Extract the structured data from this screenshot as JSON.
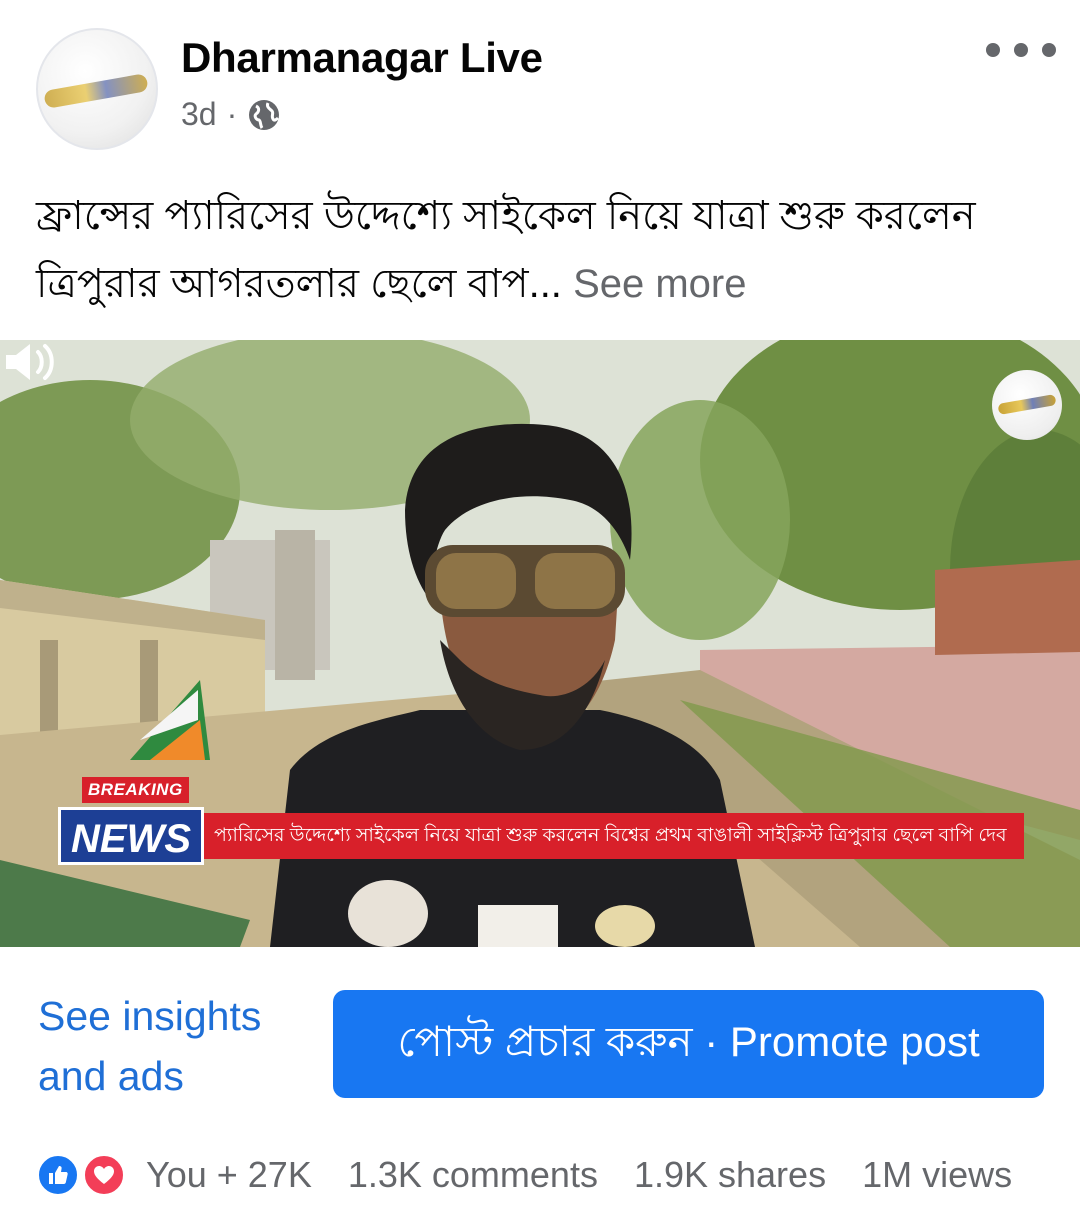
{
  "post": {
    "page_name": "Dharmanagar Live",
    "time": "3d",
    "separator": "·",
    "privacy_icon": "globe-icon",
    "more_icon": "more-options-icon",
    "caption": "ফ্রান্সের প্যারিসের উদ্দেশ্যে সাইকেল নিয়ে যাত্রা শুরু করলেন ত্রিপুরার আগরতলার ছেলে বাপ...",
    "see_more": "See more"
  },
  "video": {
    "breaking_label": "BREAKING",
    "news_label": "NEWS",
    "ticker_text": "প্যারিসের উদ্দেশ্যে সাইকেল নিয়ে যাত্রা  শুরু করলেন বিশ্বের প্রথম বাঙালী  সাইক্লিস্ট ত্রিপুরার ছেলে  বাপি দেব ",
    "mute_icon": "speaker-icon"
  },
  "actions": {
    "insights_label": "See insights and ads",
    "promote_label": "পোস্ট প্রচার করুন · Promote post"
  },
  "engagement": {
    "reactions": [
      "like-icon",
      "love-icon"
    ],
    "reaction_summary": "You + 27K",
    "comments": "1.3K comments",
    "shares": "1.9K shares",
    "views": "1M views"
  },
  "colors": {
    "accent": "#1877f2",
    "link": "#1f6fd6",
    "secondary_text": "#65676b",
    "ticker_red": "#d8202a",
    "news_blue": "#1d3f95"
  }
}
